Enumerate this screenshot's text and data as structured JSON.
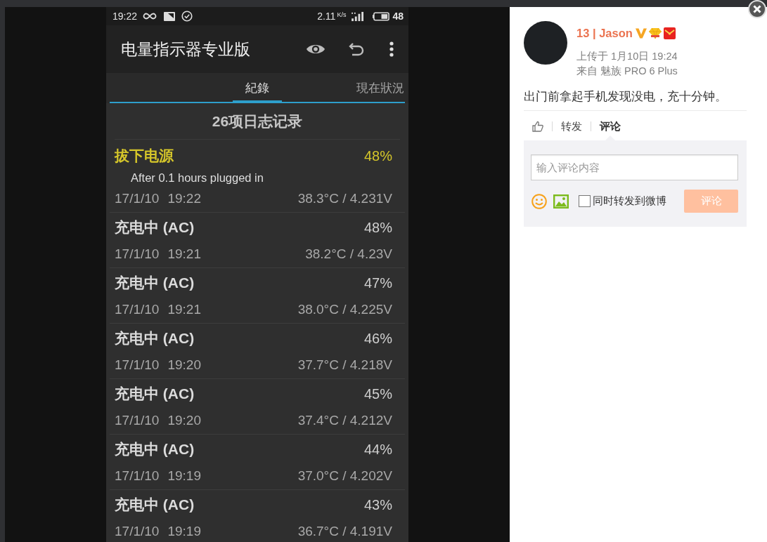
{
  "phone_screenshot": {
    "status_bar": {
      "time": "19:22",
      "network_speed": "2.11",
      "speed_unit": "K/s",
      "battery_percent": "48"
    },
    "app_bar": {
      "title": "电量指示器专业版"
    },
    "tabs": [
      {
        "label": "紀錄",
        "selected": true
      },
      {
        "label": "現在狀況",
        "selected": false
      }
    ],
    "log_heading": "26项日志记录",
    "entries": [
      {
        "kind": "unplugged",
        "title": "拔下电源",
        "percent": "48%",
        "note": "After 0.1 hours plugged in",
        "date": "17/1/10",
        "time": "19:22",
        "reading": "38.3°C / 4.231V"
      },
      {
        "kind": "charging",
        "title": "充电中 (AC)",
        "percent": "48%",
        "date": "17/1/10",
        "time": "19:21",
        "reading": "38.2°C / 4.23V"
      },
      {
        "kind": "charging",
        "title": "充电中 (AC)",
        "percent": "47%",
        "date": "17/1/10",
        "time": "19:21",
        "reading": "38.0°C / 4.225V"
      },
      {
        "kind": "charging",
        "title": "充电中 (AC)",
        "percent": "46%",
        "date": "17/1/10",
        "time": "19:20",
        "reading": "37.7°C / 4.218V"
      },
      {
        "kind": "charging",
        "title": "充电中 (AC)",
        "percent": "45%",
        "date": "17/1/10",
        "time": "19:20",
        "reading": "37.4°C / 4.212V"
      },
      {
        "kind": "charging",
        "title": "充电中 (AC)",
        "percent": "44%",
        "date": "17/1/10",
        "time": "19:19",
        "reading": "37.0°C / 4.202V"
      },
      {
        "kind": "charging",
        "title": "充电中 (AC)",
        "percent": "43%",
        "date": "17/1/10",
        "time": "19:19",
        "reading": "36.7°C / 4.191V"
      }
    ]
  },
  "post": {
    "author": "13 | Jason",
    "upload_time": "上传于 1月10日 19:24",
    "source": "来自 魅族 PRO 6 Plus",
    "text": "出门前拿起手机发现没电，充十分钟。",
    "actions": [
      {
        "label": "转发",
        "selected": false
      },
      {
        "label": "评论",
        "selected": true
      }
    ],
    "comment_form": {
      "placeholder": "输入评论内容",
      "repost_checkbox": {
        "label": "同时转发到微博",
        "checked": false
      },
      "submit": {
        "label": "评论",
        "disabled": true
      }
    }
  }
}
